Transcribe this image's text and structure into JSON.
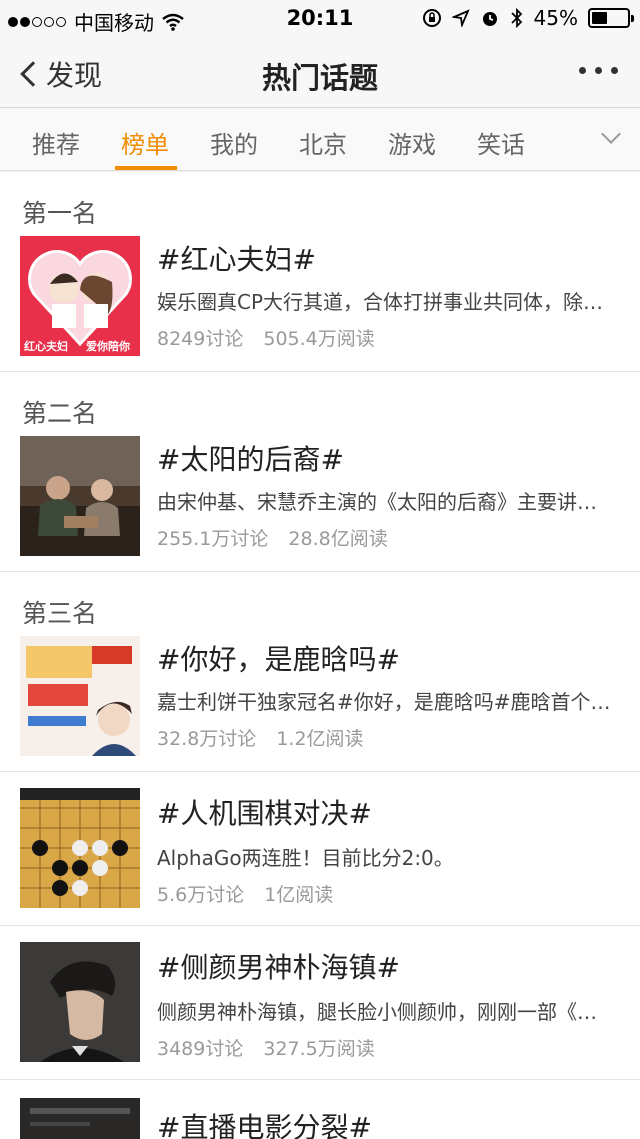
{
  "status": {
    "carrier": "中国移动",
    "time": "20:11",
    "battery_percent": "45%",
    "battery_level": 0.45
  },
  "nav": {
    "back_label": "发现",
    "title": "热门话题"
  },
  "tabs": [
    {
      "label": "推荐",
      "active": false
    },
    {
      "label": "榜单",
      "active": true
    },
    {
      "label": "我的",
      "active": false
    },
    {
      "label": "北京",
      "active": false
    },
    {
      "label": "游戏",
      "active": false
    },
    {
      "label": "笑话",
      "active": false
    }
  ],
  "ranks": {
    "first": "第一名",
    "second": "第二名",
    "third": "第三名"
  },
  "topics": [
    {
      "title": "#红心夫妇#",
      "desc": "娱乐圈真CP大行其道，合体打拼事业共同体，除…",
      "discussions": "8249讨论",
      "reads": "505.4万阅读"
    },
    {
      "title": "#太阳的后裔#",
      "desc": "由宋仲基、宋慧乔主演的《太阳的后裔》主要讲…",
      "discussions": "255.1万讨论",
      "reads": "28.8亿阅读"
    },
    {
      "title": "#你好，是鹿晗吗#",
      "desc": "嘉士利饼干独家冠名#你好，是鹿晗吗#鹿晗首个…",
      "discussions": "32.8万讨论",
      "reads": "1.2亿阅读"
    },
    {
      "title": "#人机围棋对决#",
      "desc": "AlphaGo两连胜！目前比分2:0。",
      "discussions": "5.6万讨论",
      "reads": "1亿阅读"
    },
    {
      "title": "#侧颜男神朴海镇#",
      "desc": "侧颜男神朴海镇，腿长脸小侧颜帅，刚刚一部《…",
      "discussions": "3489讨论",
      "reads": "327.5万阅读"
    },
    {
      "title": "#直播电影分裂#"
    }
  ],
  "thumb_text": {
    "t1_left": "红心夫妇",
    "t1_right": "爱你陪你"
  },
  "colors": {
    "accent": "#f28c00",
    "background": "#f2f2f2"
  }
}
